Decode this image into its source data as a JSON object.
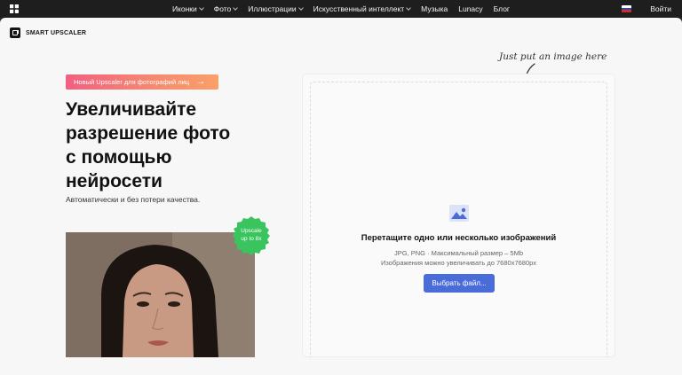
{
  "nav": {
    "items": [
      {
        "label": "Иконки",
        "dropdown": true
      },
      {
        "label": "Фото",
        "dropdown": true
      },
      {
        "label": "Иллюстрации",
        "dropdown": true
      },
      {
        "label": "Искусственный интеллект",
        "dropdown": true
      },
      {
        "label": "Музыка",
        "dropdown": false
      },
      {
        "label": "Lunacy",
        "dropdown": false
      },
      {
        "label": "Блог",
        "dropdown": false
      }
    ],
    "login_label": "Войти",
    "language_flag": "ru-flag-icon"
  },
  "brand": {
    "name": "SMART UPSCALER"
  },
  "hero": {
    "promo_label": "Новый Upscaler для фотографий лиц",
    "promo_arrow": "→",
    "headline_lines": [
      "Увеличивайте",
      "разрешение фото",
      "с помощью",
      "нейросети"
    ],
    "subtitle": "Автоматически и без потери качества.",
    "badge_line1": "Upscale",
    "badge_line2": "up to 8x"
  },
  "upload": {
    "hint": "Just put an image here",
    "title": "Перетащите одно или несколько изображений",
    "formats": "JPG, PNG · Максимальный размер – 5Mb",
    "limit": "Изображения можно увеличивать до 7680x7680px",
    "button_label": "Выбрать файл..."
  },
  "colors": {
    "topbar": "#1e1e1e",
    "page_bg": "#f7f7f7",
    "accent_button": "#4a6cd9",
    "badge_green": "#3ac45e",
    "promo_gradient_start": "#f25f82",
    "promo_gradient_end": "#f9a069"
  }
}
